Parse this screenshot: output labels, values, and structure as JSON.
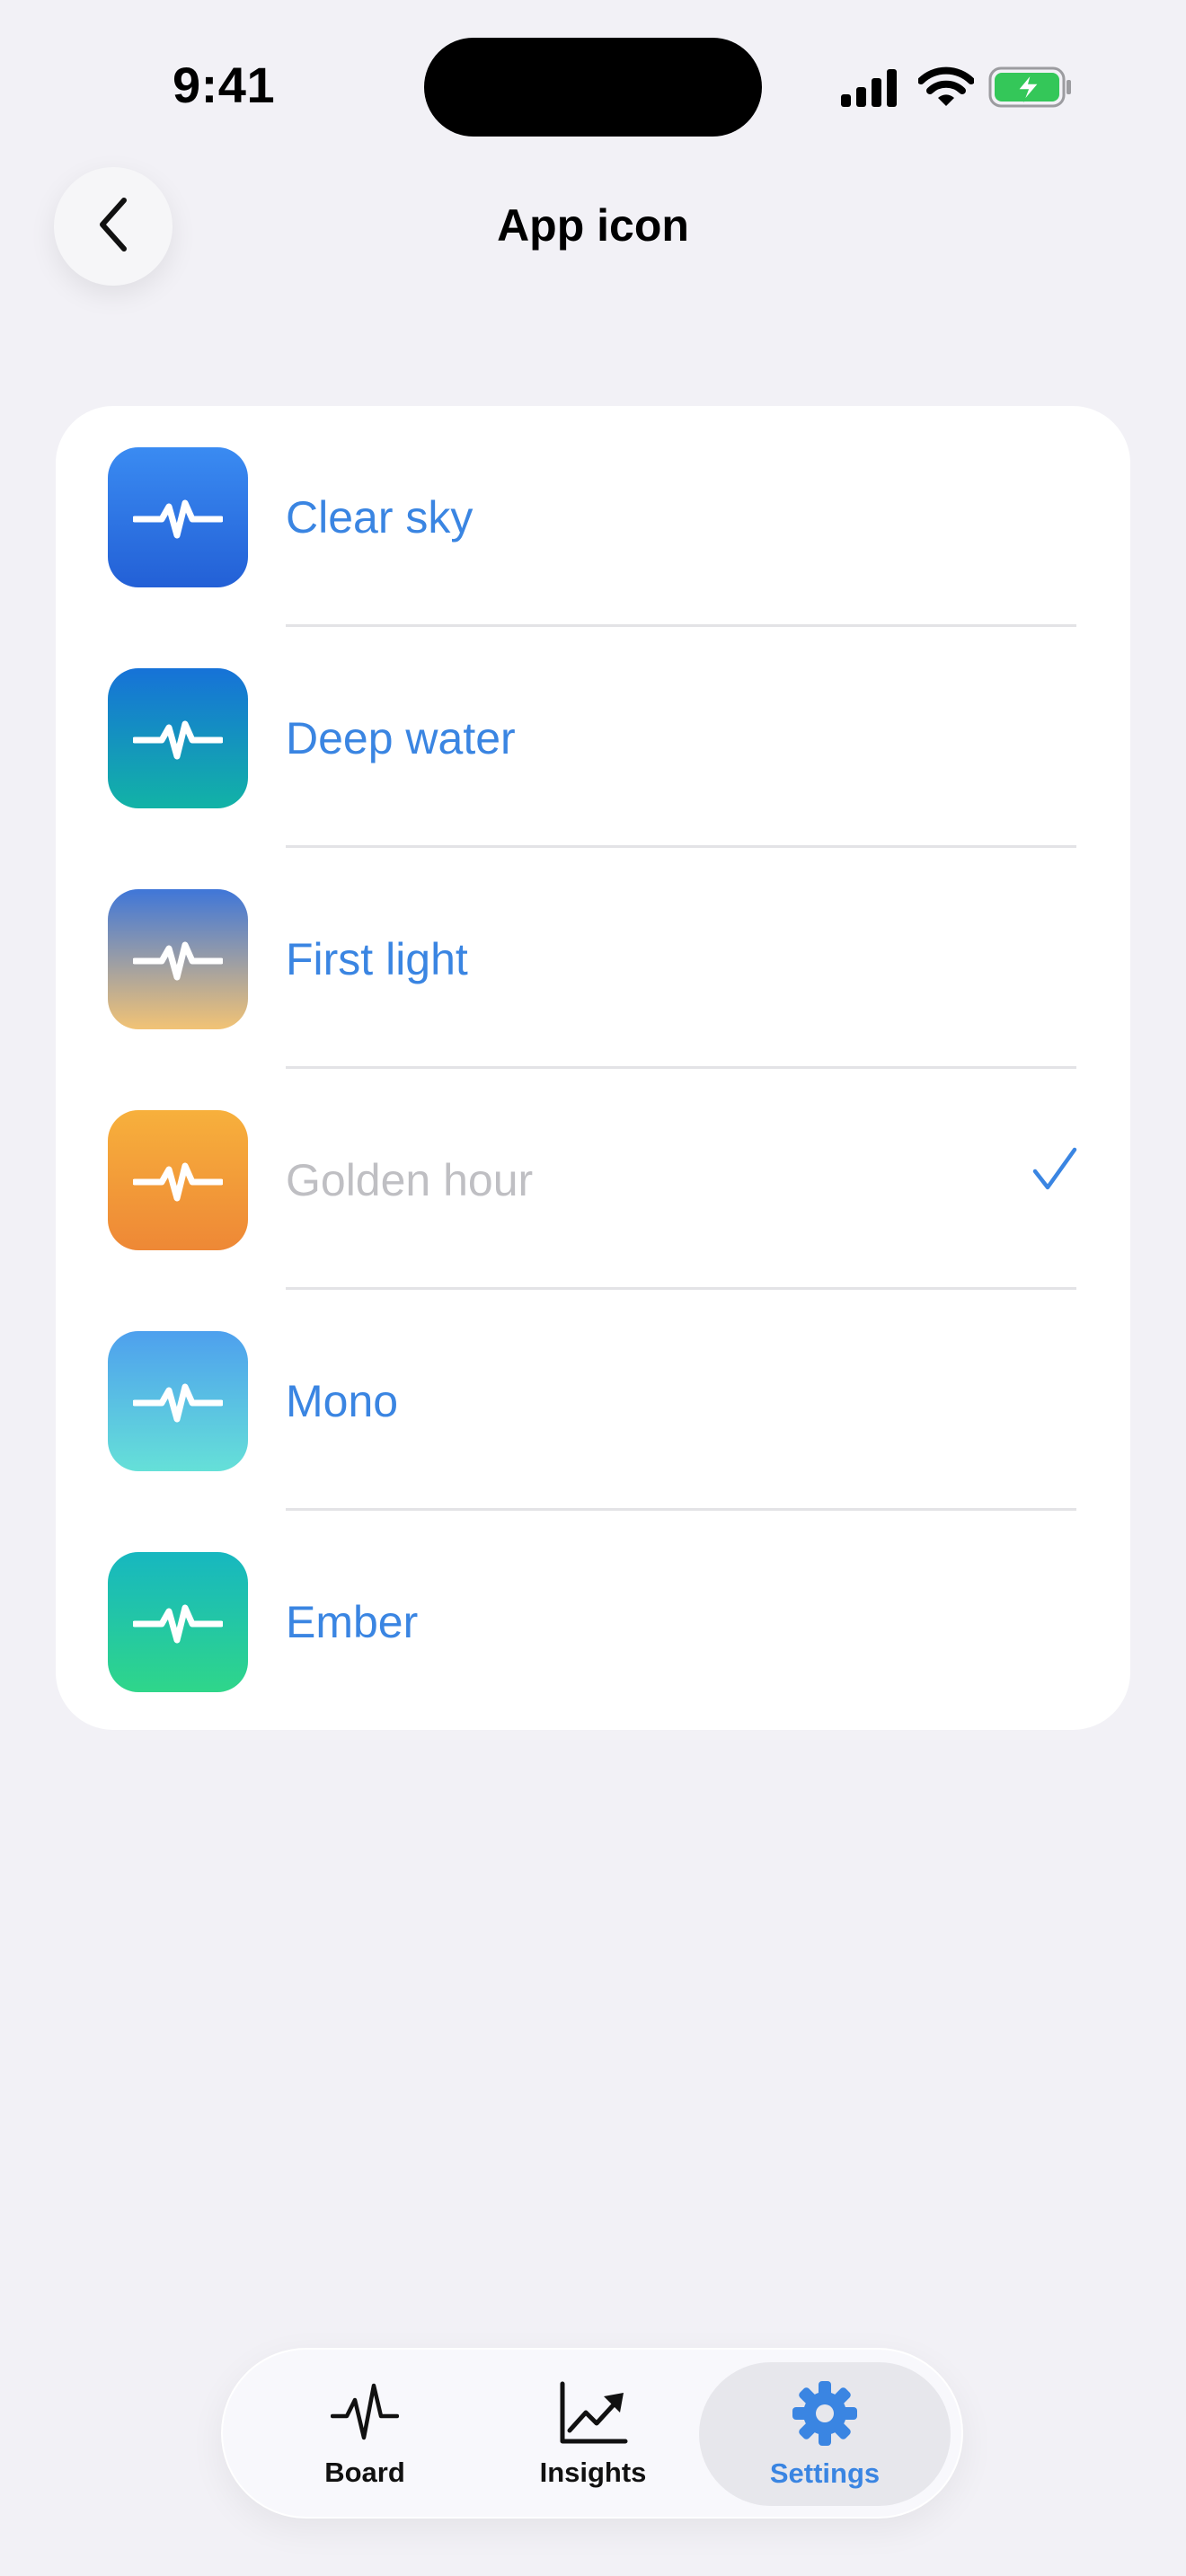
{
  "status_bar": {
    "time": "9:41"
  },
  "header": {
    "title": "App icon"
  },
  "icons": [
    {
      "name": "Clear sky",
      "gradient": [
        "#3A8BF2",
        "#2360D6"
      ],
      "selected": false
    },
    {
      "name": "Deep water",
      "gradient": [
        "#1672D8",
        "#12B3A6"
      ],
      "selected": false
    },
    {
      "name": "First light",
      "gradient": [
        "#3F76D8",
        "#F2C375"
      ],
      "selected": false
    },
    {
      "name": "Golden hour",
      "gradient": [
        "#F7B03C",
        "#EE8836"
      ],
      "selected": true
    },
    {
      "name": "Mono",
      "gradient": [
        "#4EA0EE",
        "#65E0D8"
      ],
      "selected": false
    },
    {
      "name": "Ember",
      "gradient": [
        "#17B7C0",
        "#2FD68A"
      ],
      "selected": false
    }
  ],
  "tabbar": {
    "tabs": [
      {
        "label": "Board",
        "icon": "pulse-icon",
        "selected": false
      },
      {
        "label": "Insights",
        "icon": "chart-trend-icon",
        "selected": false
      },
      {
        "label": "Settings",
        "icon": "gear-icon",
        "selected": true
      }
    ]
  },
  "colors": {
    "accent": "#3A85E2",
    "muted": "#BFBFC3",
    "background": "#F2F1F6",
    "battery": "#34C759"
  }
}
